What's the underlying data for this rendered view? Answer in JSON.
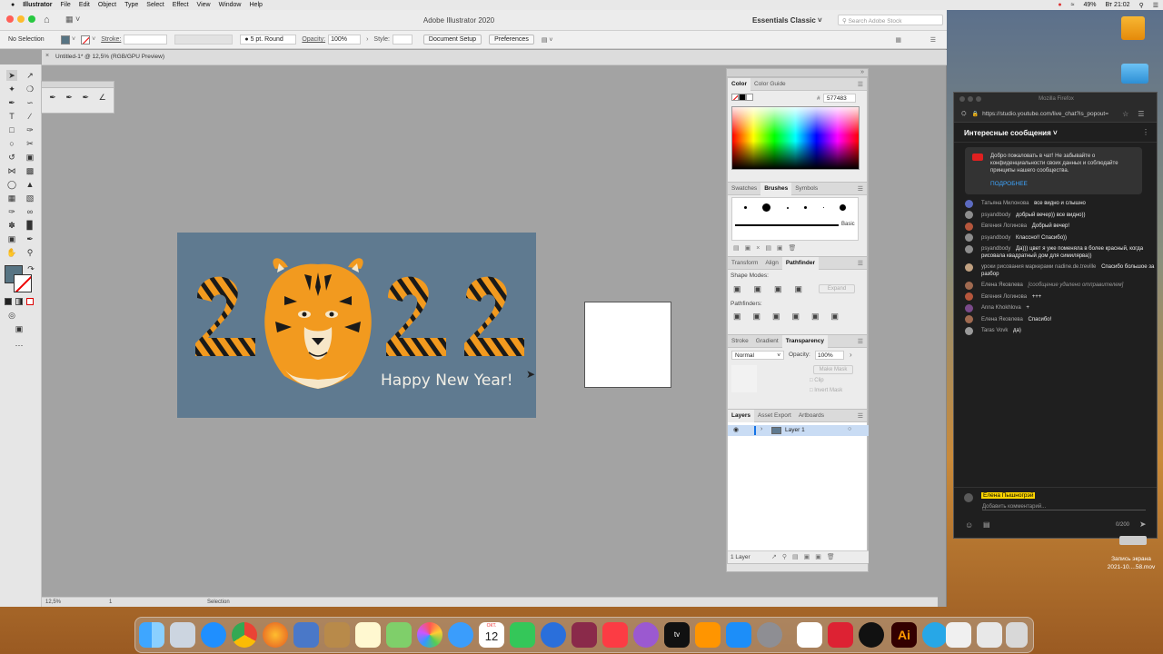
{
  "menubar": {
    "app": "Illustrator",
    "items": [
      "File",
      "Edit",
      "Object",
      "Type",
      "Select",
      "Effect",
      "View",
      "Window",
      "Help"
    ],
    "battery": "49%",
    "clock": "Вт 21:02"
  },
  "titlebar": {
    "title": "Adobe Illustrator 2020",
    "workspace": "Essentials Classic",
    "search_placeholder": "Search Adobe Stock"
  },
  "controlbar": {
    "selection": "No Selection",
    "stroke_label": "Stroke:",
    "brush": "5 pt. Round",
    "opacity_label": "Opacity:",
    "opacity": "100%",
    "style_label": "Style:",
    "doc_setup": "Document Setup",
    "preferences": "Preferences"
  },
  "doc_tab": "Untitled-1* @ 12,5% (RGB/GPU Preview)",
  "artwork": {
    "year": "2022",
    "greeting": "Happy New Year!"
  },
  "statusbar": {
    "zoom": "12,5%",
    "page": "1",
    "mode": "Selection"
  },
  "color_panel": {
    "tabs": [
      "Color",
      "Color Guide"
    ],
    "hex_label": "#",
    "hex": "577483"
  },
  "brushes_panel": {
    "tabs": [
      "Swatches",
      "Brushes",
      "Symbols"
    ],
    "basic": "Basic"
  },
  "pathfinder_panel": {
    "tabs": [
      "Transform",
      "Align",
      "Pathfinder"
    ],
    "shape_modes": "Shape Modes:",
    "expand": "Expand",
    "pathfinders": "Pathfinders:"
  },
  "transparency_panel": {
    "tabs": [
      "Stroke",
      "Gradient",
      "Transparency"
    ],
    "blend": "Normal",
    "opacity_label": "Opacity:",
    "opacity": "100%",
    "make_mask": "Make Mask",
    "clip": "Clip",
    "invert": "Invert Mask"
  },
  "layers_panel": {
    "tabs": [
      "Layers",
      "Asset Export",
      "Artboards"
    ],
    "layer_name": "Layer 1",
    "footer": "1 Layer"
  },
  "firefox": {
    "title": "Mozilla Firefox",
    "url": "https://studio.youtube.com/live_chat?is_popout=",
    "chat_title": "Интересные сообщения",
    "welcome": "Добро пожаловать в чат! Не забывайте о конфиденциальности своих данных и соблюдайте принципы нашего сообщества.",
    "more": "ПОДРОБНЕЕ",
    "messages": [
      {
        "author": "Татьяна Милонова",
        "text": "все видно и слышно",
        "avatar_color": "#5c6bc0"
      },
      {
        "author": "psyandbody",
        "text": "добрый вечер)) все видно))",
        "avatar_color": "#8d8d8d"
      },
      {
        "author": "Евгения Логинова",
        "text": "Добрый вечер!",
        "avatar_color": "#b5563c"
      },
      {
        "author": "psyandbody",
        "text": "Классно!! Спасибо))",
        "avatar_color": "#8d8d8d"
      },
      {
        "author": "psyandbody",
        "text": "Да))) цвет я уже поменяла в более красный, когда рисовала квадратный дом для симилярва))",
        "avatar_color": "#8d8d8d"
      },
      {
        "author": "уроки рисования маркерами nadine.de.treville",
        "text": "Спасибо большое за разбор",
        "avatar_color": "#c0a080"
      },
      {
        "author": "Елена Яковлева",
        "text": "[сообщение удалено отправителем]",
        "avatar_color": "#a06a50"
      },
      {
        "author": "Евгения Логинова",
        "text": "+++",
        "avatar_color": "#b5563c"
      },
      {
        "author": "Anna Khokhlova",
        "text": "+",
        "avatar_color": "#7a4a8a"
      },
      {
        "author": "Елена Яковлева",
        "text": "Спасибо!",
        "avatar_color": "#a06a50"
      },
      {
        "author": "Taras Vovk",
        "text": "да)",
        "avatar_color": "#9a9a9a"
      }
    ],
    "me": "Елена Пышногрэй",
    "placeholder": "Добавить комментарий...",
    "counter": "0/200"
  },
  "desktop": {
    "recording_label": "Запись экрана",
    "recording_date": "2021-10....58.mov"
  },
  "dock": {
    "calendar_day": "12",
    "calendar_month": "ОКТ."
  },
  "colors": {
    "artboard": "#5f7a90",
    "tiger_orange": "#f29a1f",
    "accent_blue": "#1473e6"
  }
}
